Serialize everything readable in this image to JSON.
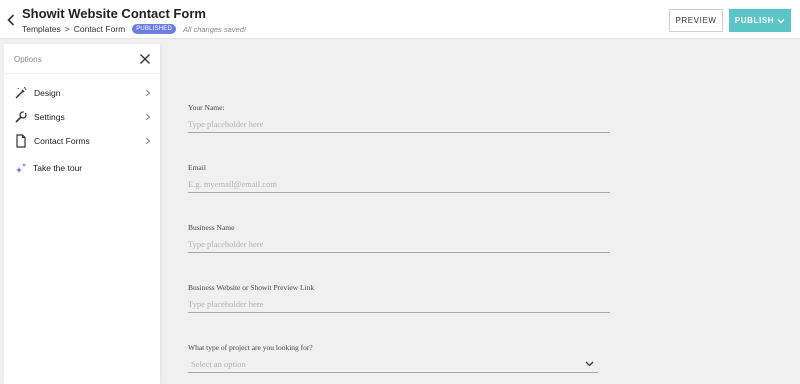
{
  "header": {
    "title": "Showit Website Contact Form",
    "breadcrumb": [
      "Templates",
      ">",
      "Contact Form"
    ],
    "status_badge": "PUBLISHED",
    "save_status": "All changes saved!",
    "preview_label": "PREVIEW",
    "publish_label": "PUBLISH",
    "accent_color": "#5cc5c6",
    "badge_color": "#6c7ee1"
  },
  "sidebar": {
    "title": "Options",
    "items": [
      {
        "label": "Design",
        "icon": "magic-wand-icon"
      },
      {
        "label": "Settings",
        "icon": "wrench-icon"
      },
      {
        "label": "Contact Forms",
        "icon": "document-icon"
      }
    ],
    "tour_label": "Take the tour",
    "tour_icon": "sparkle-icon"
  },
  "form": {
    "fields": [
      {
        "label": "Your Name:",
        "placeholder": "Type placeholder here"
      },
      {
        "label": "Email",
        "placeholder": "E.g. myemail@email.com"
      },
      {
        "label": "Business Name",
        "placeholder": "Type placeholder here"
      },
      {
        "label": "Business Website or Showit Preview Link",
        "placeholder": "Type placeholder here"
      }
    ],
    "select": {
      "label": "What type of project are you looking for?",
      "placeholder": "Select an option"
    }
  }
}
